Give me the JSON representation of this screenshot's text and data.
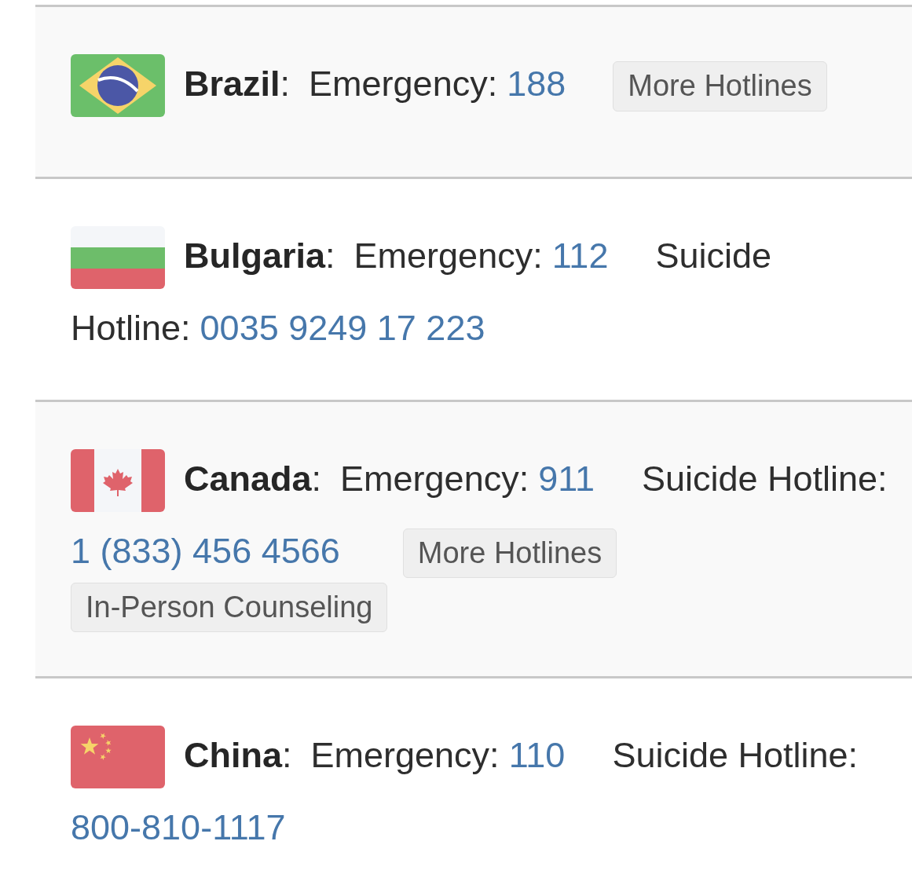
{
  "countries": [
    {
      "flag": {
        "kind": "brazil"
      },
      "name": "**Brazil**:",
      "emergency": {
        "label": "Emergency:",
        "number": "188"
      },
      "buttons": [
        "More Hotlines"
      ]
    },
    {
      "flag": {
        "kind": "bulgaria"
      },
      "name": "**Bulgaria**:",
      "emergency": {
        "label": "Emergency:",
        "number": "112"
      },
      "hotline": {
        "label": [
          "Suicide",
          "Hotline:"
        ],
        "number": "0035 9249 17 223"
      }
    },
    {
      "flag": {
        "kind": "canada"
      },
      "name": "**Canada**:",
      "emergency": {
        "label": "Emergency:",
        "number": "911"
      },
      "hotline": {
        "label": [
          "Suicide Hotline:"
        ],
        "number": "1 (833) 456 4566"
      },
      "buttons": [
        "More Hotlines",
        "In-Person Counseling"
      ]
    },
    {
      "flag": {
        "kind": "china"
      },
      "name": "**China**:",
      "emergency": {
        "label": "Emergency:",
        "number": "110"
      },
      "hotline": {
        "label": [
          "Suicide Hotline:"
        ],
        "number": "800-810-1117"
      }
    }
  ]
}
